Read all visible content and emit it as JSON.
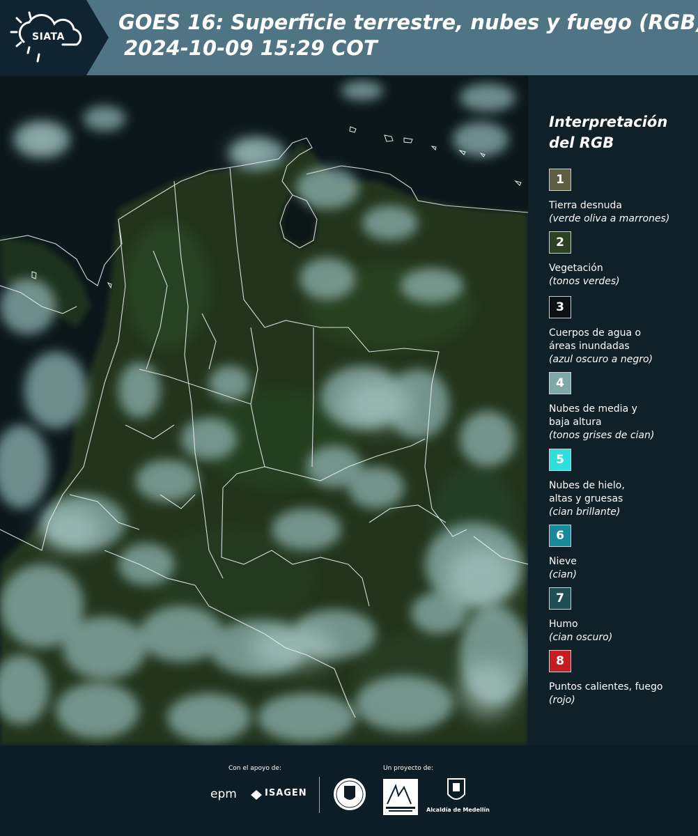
{
  "header": {
    "logo_text": "SIATA",
    "title_line1": "GOES 16: Superficie terrestre, nubes y fuego (RGB)",
    "title_line2": "2024-10-09 15:29 COT"
  },
  "legend": {
    "title_line1": "Interpretación",
    "title_line2": "del RGB",
    "items": [
      {
        "number": "1",
        "label": "Tierra desnuda",
        "desc": "(verde oliva a marrones)",
        "color": "#5e5e45"
      },
      {
        "number": "2",
        "label": "Vegetación",
        "desc": "(tonos verdes)",
        "color": "#2d4123"
      },
      {
        "number": "3",
        "label": "Cuerpos de agua o áreas inundadas",
        "desc": "(azul oscuro a negro)",
        "color": "#0b1116"
      },
      {
        "number": "4",
        "label": "Nubes de media y baja altura",
        "desc": "(tonos grises de cian)",
        "color": "#7fa9a7"
      },
      {
        "number": "5",
        "label": "Nubes de hielo, altas y gruesas",
        "desc": "(cian brillante)",
        "color": "#2ee0dc"
      },
      {
        "number": "6",
        "label": "Nieve",
        "desc": "(cian)",
        "color": "#17899b"
      },
      {
        "number": "7",
        "label": "Humo",
        "desc": "(cian oscuro)",
        "color": "#1d4f55"
      },
      {
        "number": "8",
        "label": "Puntos calientes, fuego",
        "desc": "(rojo)",
        "color": "#c41e22"
      }
    ]
  },
  "footer": {
    "support_label": "Con el apoyo de:",
    "project_label": "Un proyecto de:",
    "epm": "epm",
    "isagen": "ISAGEN",
    "alcaldia": "Alcaldía de Medellín"
  }
}
